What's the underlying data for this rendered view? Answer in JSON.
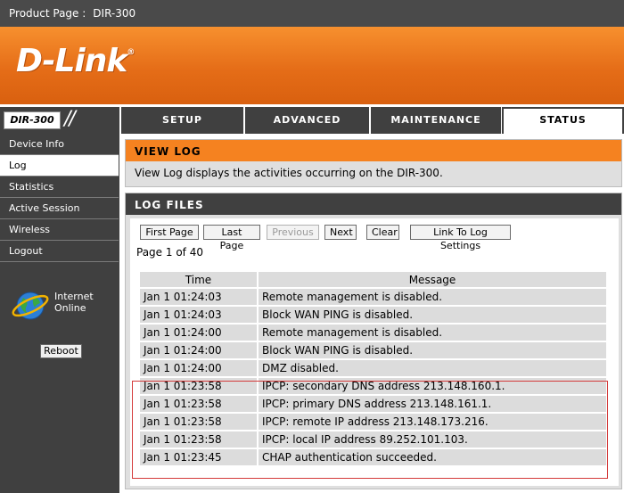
{
  "topbar": {
    "label": "Product Page :",
    "value": "DIR-300"
  },
  "logo": {
    "text": "D-Link"
  },
  "model": {
    "name": "DIR-300"
  },
  "nav": {
    "tabs": [
      {
        "label": "SETUP"
      },
      {
        "label": "ADVANCED"
      },
      {
        "label": "MAINTENANCE"
      },
      {
        "label": "STATUS"
      }
    ]
  },
  "sidebar": {
    "items": [
      {
        "label": "Device Info"
      },
      {
        "label": "Log"
      },
      {
        "label": "Statistics"
      },
      {
        "label": "Active Session"
      },
      {
        "label": "Wireless"
      },
      {
        "label": "Logout"
      }
    ],
    "status_line1": "Internet",
    "status_line2": "Online",
    "reboot_label": "Reboot"
  },
  "view_log": {
    "title": "VIEW LOG",
    "description": "View Log displays the activities occurring on the DIR-300."
  },
  "log_files": {
    "title": "LOG FILES",
    "buttons": {
      "first": "First Page",
      "last": "Last Page",
      "previous": "Previous",
      "next": "Next",
      "clear": "Clear",
      "link": "Link To Log Settings"
    },
    "page_info": "Page 1 of 40",
    "columns": {
      "time": "Time",
      "message": "Message"
    },
    "rows": [
      {
        "time": "Jan 1 01:24:03",
        "message": "Remote management is disabled."
      },
      {
        "time": "Jan 1 01:24:03",
        "message": "Block WAN PING is disabled."
      },
      {
        "time": "Jan 1 01:24:00",
        "message": "Remote management is disabled."
      },
      {
        "time": "Jan 1 01:24:00",
        "message": "Block WAN PING is disabled."
      },
      {
        "time": "Jan 1 01:24:00",
        "message": "DMZ disabled."
      },
      {
        "time": "Jan 1 01:23:58",
        "message": "IPCP: secondary DNS address 213.148.160.1."
      },
      {
        "time": "Jan 1 01:23:58",
        "message": "IPCP: primary DNS address 213.148.161.1."
      },
      {
        "time": "Jan 1 01:23:58",
        "message": "IPCP: remote IP address 213.148.173.216."
      },
      {
        "time": "Jan 1 01:23:58",
        "message": "IPCP: local IP address 89.252.101.103."
      },
      {
        "time": "Jan 1 01:23:45",
        "message": "CHAP authentication succeeded."
      }
    ]
  },
  "colors": {
    "accent": "#f58220",
    "nav_bg": "#404040",
    "highlight": "#d43a3a"
  }
}
